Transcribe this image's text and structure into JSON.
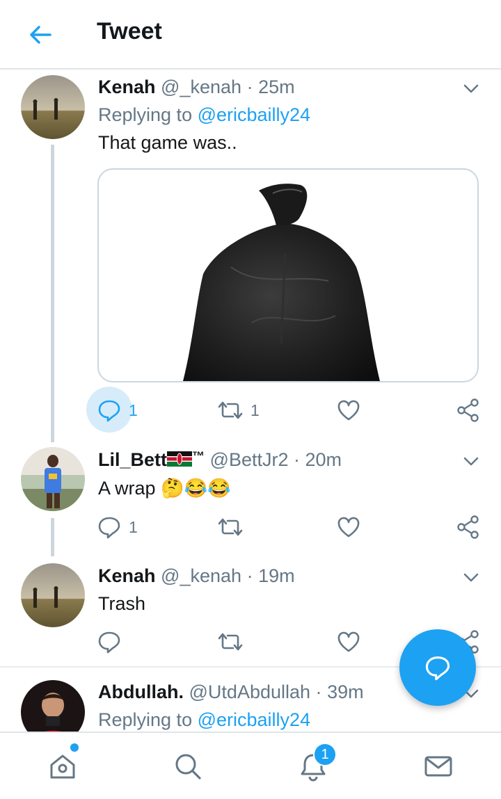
{
  "header": {
    "title": "Tweet",
    "back_icon": "arrow-left-icon"
  },
  "tweets": [
    {
      "name": "Kenah",
      "handle": "@_kenah",
      "separator": "·",
      "time": "25m",
      "replying_prefix": "Replying to",
      "replying_to": "@ericbailly24",
      "text": "That game was..",
      "media": "black trash bag image",
      "reply_count": "1",
      "retweet_count": "1"
    },
    {
      "name": "Lil_Bett",
      "name_suffix": "™",
      "handle": "@BettJr2",
      "separator": "·",
      "time": "20m",
      "text": "A wrap 🤔😂😂",
      "reply_count": "1"
    },
    {
      "name": "Kenah",
      "handle": "@_kenah",
      "separator": "·",
      "time": "19m",
      "text": "Trash"
    },
    {
      "name": "Abdullah.",
      "handle": "@UtdAbdullah",
      "separator": "·",
      "time": "39m",
      "replying_prefix": "Replying to",
      "replying_to": "@ericbailly24"
    }
  ],
  "bottom_nav": {
    "items": [
      "home-icon",
      "search-icon",
      "notifications-icon",
      "messages-icon"
    ],
    "notifications_badge": "1"
  },
  "colors": {
    "accent": "#1da1f2",
    "secondary_text": "#657786",
    "divider": "#e6ecf0"
  }
}
